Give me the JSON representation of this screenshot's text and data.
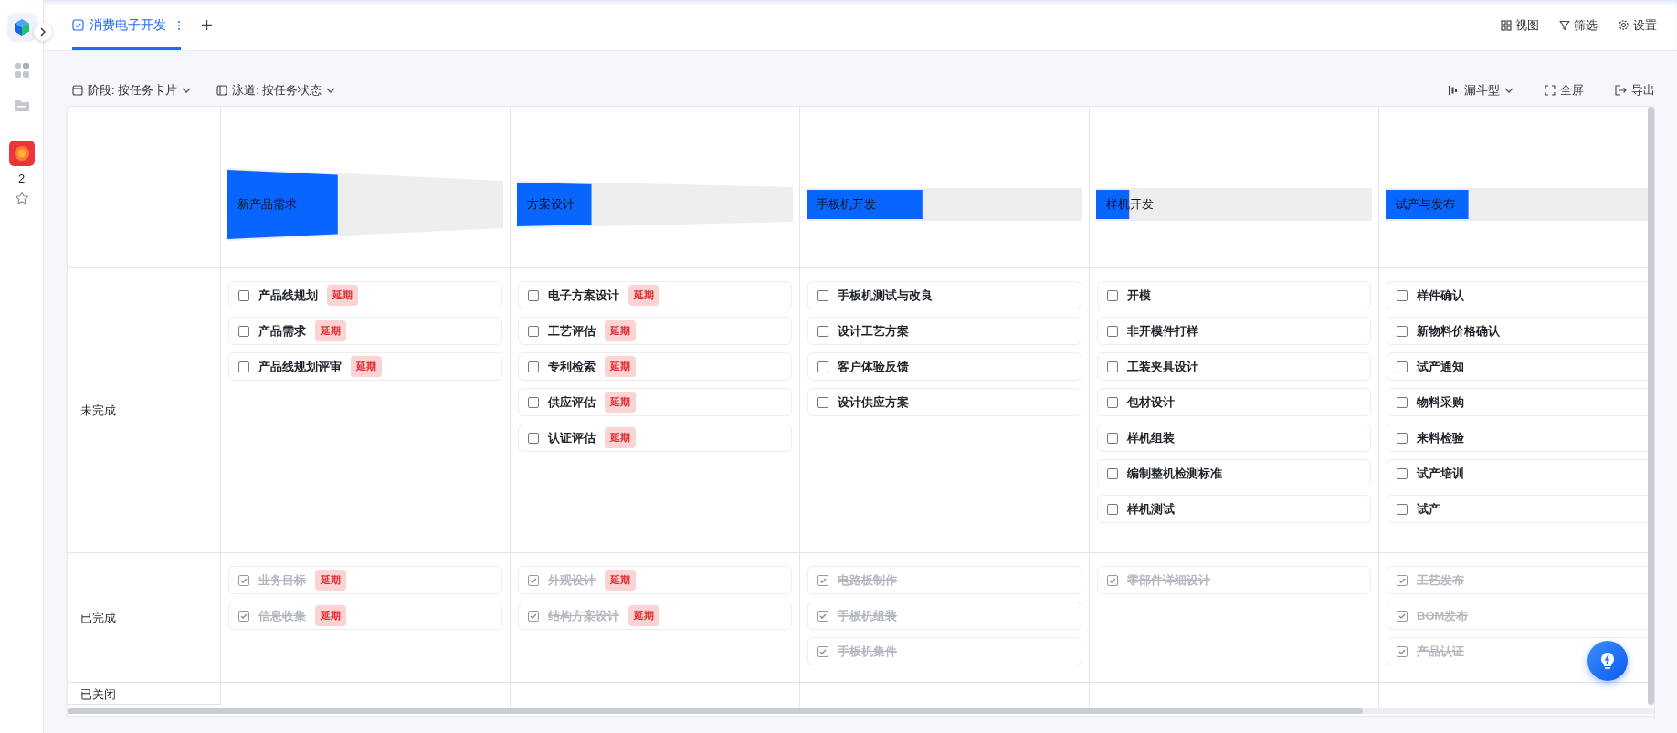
{
  "sidebar": {
    "count": "2"
  },
  "tab": {
    "label": "消费电子开发",
    "selected": true
  },
  "top_actions": [
    {
      "kind": "view",
      "label": "视图"
    },
    {
      "kind": "filter",
      "label": "筛选"
    },
    {
      "kind": "settings",
      "label": "设置"
    }
  ],
  "toolbar": {
    "stage_selector": "阶段: 按任务卡片",
    "lane_selector": "泳道: 按任务状态",
    "chart_type": "漏斗型",
    "fullscreen": "全屏",
    "export": "导出"
  },
  "stages": [
    {
      "name": "新产品需求",
      "level": 0.4
    },
    {
      "name": "方案设计",
      "level": 0.27
    },
    {
      "name": "手板机开发",
      "level": 0.42
    },
    {
      "name": "样机开发",
      "level": 0.12
    },
    {
      "name": "试产与发布",
      "level": 0.3
    }
  ],
  "lanes": [
    {
      "name": "未完成",
      "cells": [
        [
          {
            "title": "产品线规划",
            "done": false,
            "tag": "延期"
          },
          {
            "title": "产品需求",
            "done": false,
            "tag": "延期"
          },
          {
            "title": "产品线规划评审",
            "done": false,
            "tag": "延期"
          }
        ],
        [
          {
            "title": "电子方案设计",
            "done": false,
            "tag": "延期"
          },
          {
            "title": "工艺评估",
            "done": false,
            "tag": "延期"
          },
          {
            "title": "专利检索",
            "done": false,
            "tag": "延期"
          },
          {
            "title": "供应评估",
            "done": false,
            "tag": "延期"
          },
          {
            "title": "认证评估",
            "done": false,
            "tag": "延期"
          }
        ],
        [
          {
            "title": "手板机测试与改良",
            "done": false
          },
          {
            "title": "设计工艺方案",
            "done": false
          },
          {
            "title": "客户体验反馈",
            "done": false
          },
          {
            "title": "设计供应方案",
            "done": false
          }
        ],
        [
          {
            "title": "开模",
            "done": false
          },
          {
            "title": "非开模件打样",
            "done": false
          },
          {
            "title": "工装夹具设计",
            "done": false
          },
          {
            "title": "包材设计",
            "done": false
          },
          {
            "title": "样机组装",
            "done": false
          },
          {
            "title": "编制整机检测标准",
            "done": false
          },
          {
            "title": "样机测试",
            "done": false
          }
        ],
        [
          {
            "title": "样件确认",
            "done": false
          },
          {
            "title": "新物料价格确认",
            "done": false
          },
          {
            "title": "试产通知",
            "done": false
          },
          {
            "title": "物料采购",
            "done": false
          },
          {
            "title": "来料检验",
            "done": false
          },
          {
            "title": "试产培训",
            "done": false
          },
          {
            "title": "试产",
            "done": false
          }
        ]
      ]
    },
    {
      "name": "已完成",
      "cells": [
        [
          {
            "title": "业务目标",
            "done": true,
            "tag": "延期"
          },
          {
            "title": "信息收集",
            "done": true,
            "tag": "延期"
          }
        ],
        [
          {
            "title": "外观设计",
            "done": true,
            "tag": "延期"
          },
          {
            "title": "结构方案设计",
            "done": true,
            "tag": "延期"
          }
        ],
        [
          {
            "title": "电路板制作",
            "done": true
          },
          {
            "title": "手板机组装",
            "done": true
          },
          {
            "title": "手板机集件",
            "done": true
          }
        ],
        [
          {
            "title": "零部件详细设计",
            "done": true
          }
        ],
        [
          {
            "title": "工艺发布",
            "done": true
          },
          {
            "title": "BOM发布",
            "done": true
          },
          {
            "title": "产品认证",
            "done": true
          }
        ]
      ]
    },
    {
      "name": "已关闭"
    }
  ]
}
